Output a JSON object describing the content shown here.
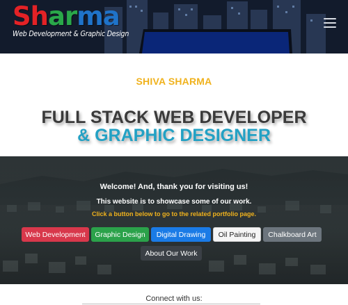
{
  "brand": {
    "logo_letters": [
      {
        "char": "S",
        "color": "#e32226"
      },
      {
        "char": "h",
        "color": "#e32226"
      },
      {
        "char": "a",
        "color": "#2aa84a"
      },
      {
        "char": "r",
        "color": "#2aa84a"
      },
      {
        "char": "m",
        "color": "#1f73c9"
      },
      {
        "char": "a",
        "color": "#1f73c9"
      }
    ],
    "tagline": "Web Development & Graphic Design"
  },
  "nav": {
    "menu_icon": "hamburger-menu-icon"
  },
  "hero": {
    "eyebrow": "SHIVA SHARMA",
    "headline_line1": "FULL STACK WEB DEVELOPER",
    "headline_line2": "& GRAPHIC DESIGNER"
  },
  "welcome": {
    "greeting": "Welcome! And, thank you for visiting us!",
    "purpose": "This website is to showcase some of our work.",
    "instruction": "Click a button below to go to the related portfolio page."
  },
  "portfolio_buttons": [
    {
      "label": "Web Development",
      "color": "#d8384b"
    },
    {
      "label": "Graphic Design",
      "color": "#2ba24a"
    },
    {
      "label": "Digital Drawing",
      "color": "#1a7be6"
    },
    {
      "label": "Oil Painting",
      "color": "#f5f5f5"
    },
    {
      "label": "Chalkboard Art",
      "color": "#6c757d"
    },
    {
      "label": "About Our Work",
      "color": "#3b4046"
    }
  ],
  "footer": {
    "connect_label": "Connect with us:"
  },
  "colors": {
    "accent_yellow": "#f0b21d",
    "accent_blue": "#23a1c4"
  }
}
